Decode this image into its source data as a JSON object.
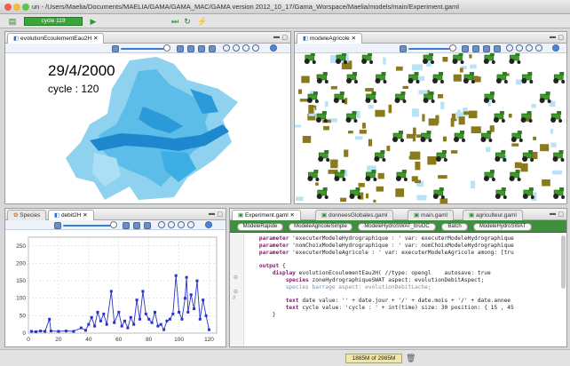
{
  "window": {
    "title": "un - /Users/Maelia/Documents/MAELIA/GAMA/GAMA_MAC/GAMA version 2012_10_17/Gama_Worspace/Maelia/models/main/Experiment.gaml"
  },
  "toolbar": {
    "cycle_label": "cycle 119"
  },
  "panels": {
    "top_left": {
      "tab_label": "evolutionEcoulementEau2H",
      "date": "29/4/2000",
      "cycle": "cycle : 120"
    },
    "top_right": {
      "tab_label": "modeleAgricole"
    },
    "bottom_left": {
      "tabs": [
        "Species",
        "debit2H"
      ]
    }
  },
  "editor": {
    "tabs": [
      "Experiment.gaml",
      "donneesGlobales.gaml",
      "main.gaml",
      "agriculteur.gaml"
    ],
    "experiment_buttons": [
      "ModeleRapide",
      "ModeleAgricoleSimple",
      "ModeleHydroSWAT_bruOC",
      "Batch",
      "ModeleHydroSWAT"
    ],
    "code_lines": [
      {
        "indent": "    ",
        "k": "parameter ",
        "s": "'executerModeleHydrographique : ' var: executerModeleHydrographique"
      },
      {
        "indent": "    ",
        "k": "parameter ",
        "s": "'nomChoixModeleHydrographique : ' var: nomChoixModeleHydrographique"
      },
      {
        "indent": "    ",
        "k": "parameter ",
        "s": "'executerModeleAgricole : ' var: executerModeleAgricole among: [tru"
      },
      {
        "indent": "",
        "k": "",
        "s": ""
      },
      {
        "indent": "    ",
        "k": "output ",
        "s": "{"
      },
      {
        "indent": "        ",
        "k": "display ",
        "s": "evolutionEcoulementEau2H( //type: opengl    autosave: true"
      },
      {
        "indent": "            ",
        "k": "species ",
        "s": "zoneHydrographiqueSWAT aspect: evolutionDebitAspect;"
      },
      {
        "indent": "            ",
        "k": "",
        "s": "species barrage aspect: evolutionDebitLache;"
      },
      {
        "indent": "",
        "k": "",
        "s": ""
      },
      {
        "indent": "            ",
        "k": "text ",
        "s": "date value: '' + date.jour + '/' + date.mois + '/' + date.annee"
      },
      {
        "indent": "            ",
        "k": "text ",
        "s": "cycle value: 'cycle : ' + int(time) size: 30 position: { 15 , 45"
      },
      {
        "indent": "        ",
        "k": "",
        "s": "}"
      }
    ]
  },
  "chart_data": {
    "type": "line",
    "title": "",
    "xlabel": "",
    "ylabel": "",
    "xlim": [
      0,
      125
    ],
    "ylim": [
      0,
      275
    ],
    "xticks": [
      "0",
      "20",
      "40",
      "60",
      "80",
      "100",
      "120"
    ],
    "yticks": [
      "0",
      "50",
      "100",
      "150",
      "200",
      "250"
    ],
    "series": [
      {
        "color": "#2733c9",
        "points": [
          [
            2,
            5
          ],
          [
            5,
            4
          ],
          [
            8,
            6
          ],
          [
            11,
            5
          ],
          [
            14,
            40
          ],
          [
            15,
            6
          ],
          [
            20,
            5
          ],
          [
            25,
            6
          ],
          [
            30,
            5
          ],
          [
            35,
            15
          ],
          [
            38,
            8
          ],
          [
            40,
            25
          ],
          [
            42,
            45
          ],
          [
            44,
            20
          ],
          [
            46,
            60
          ],
          [
            48,
            35
          ],
          [
            50,
            55
          ],
          [
            52,
            25
          ],
          [
            55,
            120
          ],
          [
            57,
            30
          ],
          [
            60,
            60
          ],
          [
            62,
            20
          ],
          [
            64,
            35
          ],
          [
            66,
            15
          ],
          [
            68,
            45
          ],
          [
            70,
            25
          ],
          [
            72,
            95
          ],
          [
            74,
            40
          ],
          [
            76,
            120
          ],
          [
            78,
            55
          ],
          [
            80,
            40
          ],
          [
            82,
            30
          ],
          [
            84,
            60
          ],
          [
            86,
            20
          ],
          [
            88,
            25
          ],
          [
            90,
            10
          ],
          [
            92,
            35
          ],
          [
            94,
            40
          ],
          [
            96,
            55
          ],
          [
            98,
            165
          ],
          [
            100,
            60
          ],
          [
            102,
            40
          ],
          [
            104,
            100
          ],
          [
            105,
            160
          ],
          [
            106,
            60
          ],
          [
            108,
            110
          ],
          [
            110,
            70
          ],
          [
            112,
            150
          ],
          [
            114,
            40
          ],
          [
            116,
            95
          ],
          [
            118,
            50
          ],
          [
            120,
            10
          ]
        ]
      }
    ]
  },
  "status": {
    "memory": "1885M of 2985M"
  }
}
